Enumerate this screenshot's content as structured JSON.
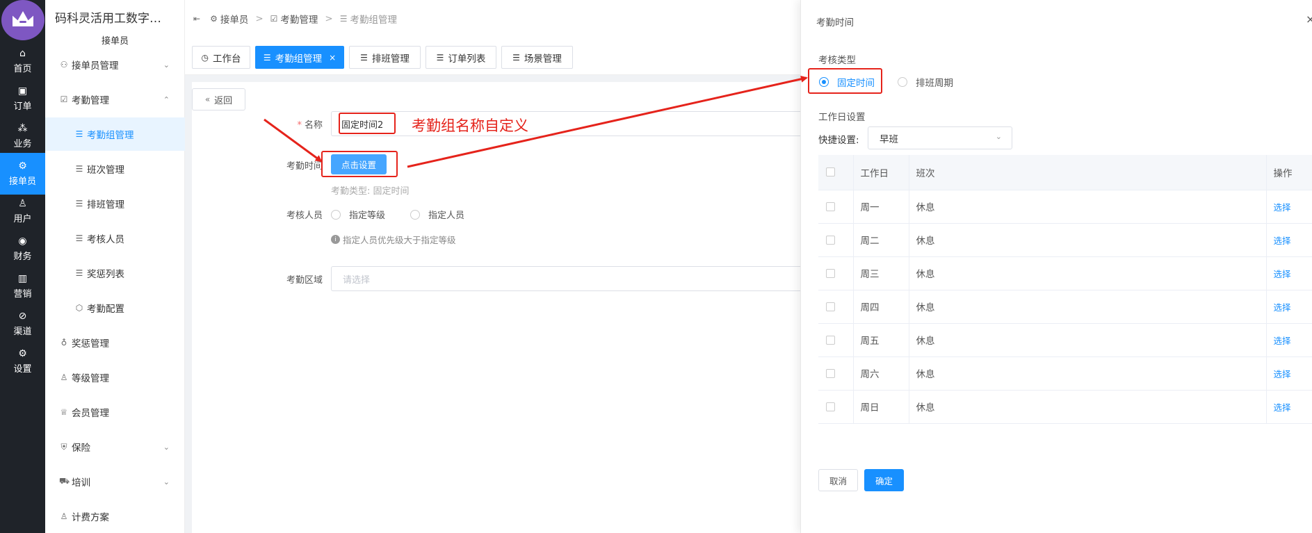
{
  "rail": [
    {
      "label": "首页",
      "icon": "⌂"
    },
    {
      "label": "订单",
      "icon": "▣"
    },
    {
      "label": "业务",
      "icon": "⁂"
    },
    {
      "label": "接单员",
      "icon": "⚙"
    },
    {
      "label": "用户",
      "icon": "♙"
    },
    {
      "label": "财务",
      "icon": "◉"
    },
    {
      "label": "营销",
      "icon": "▥"
    },
    {
      "label": "渠道",
      "icon": "⊘"
    },
    {
      "label": "设置",
      "icon": "⚙"
    }
  ],
  "sidebar": {
    "app_name": "码科灵活用工数字…",
    "role": "接单员",
    "items": [
      {
        "label": "接单员管理",
        "icon": "⚇",
        "chevron": "⌄"
      },
      {
        "label": "考勤管理",
        "icon": "☑",
        "chevron": "⌃"
      },
      {
        "label": "考勤组管理",
        "icon": "☰"
      },
      {
        "label": "班次管理",
        "icon": "☰"
      },
      {
        "label": "排班管理",
        "icon": "☰"
      },
      {
        "label": "考核人员",
        "icon": "☰"
      },
      {
        "label": "奖惩列表",
        "icon": "☰"
      },
      {
        "label": "考勤配置",
        "icon": "⬡"
      },
      {
        "label": "奖惩管理",
        "icon": "♁"
      },
      {
        "label": "等级管理",
        "icon": "♙"
      },
      {
        "label": "会员管理",
        "icon": "♕"
      },
      {
        "label": "保险",
        "icon": "⛨",
        "chevron": "⌄"
      },
      {
        "label": "培训",
        "icon": "⛟",
        "chevron": "⌄"
      },
      {
        "label": "计费方案",
        "icon": "♙"
      }
    ]
  },
  "breadcrumb": {
    "toggle": "⇤",
    "items": [
      "接单员",
      "考勤管理",
      "考勤组管理"
    ],
    "sep": ">"
  },
  "tabs": [
    {
      "label": "工作台",
      "icon": "◷"
    },
    {
      "label": "考勤组管理",
      "icon": "☰",
      "close": "×"
    },
    {
      "label": "排班管理",
      "icon": "☰"
    },
    {
      "label": "订单列表",
      "icon": "☰"
    },
    {
      "label": "场景管理",
      "icon": "☰"
    }
  ],
  "form": {
    "back": "返回",
    "back_icon": "«",
    "name_label": "名称",
    "required_mark": "*",
    "name_value": "固定时间2",
    "name_annotation": "考勤组名称自定义",
    "time_label": "考勤时间",
    "set_button": "点击设置",
    "type_hint": "考勤类型:  固定时间",
    "staff_label": "考核人员",
    "staff_options": [
      "指定等级",
      "指定人员"
    ],
    "info_hint": "指定人员优先级大于指定等级",
    "area_label": "考勤区域",
    "area_placeholder": "请选择"
  },
  "drawer": {
    "title": "考勤时间",
    "close": "×",
    "type_label": "考核类型",
    "type_options": [
      "固定时间",
      "排班周期"
    ],
    "workday_label": "工作日设置",
    "quick_label": "快捷设置:",
    "quick_value": "早班",
    "table": {
      "headers": [
        "工作日",
        "班次",
        "操作"
      ],
      "rows": [
        {
          "day": "周一",
          "shift": "休息",
          "op": "选择"
        },
        {
          "day": "周二",
          "shift": "休息",
          "op": "选择"
        },
        {
          "day": "周三",
          "shift": "休息",
          "op": "选择"
        },
        {
          "day": "周四",
          "shift": "休息",
          "op": "选择"
        },
        {
          "day": "周五",
          "shift": "休息",
          "op": "选择"
        },
        {
          "day": "周六",
          "shift": "休息",
          "op": "选择"
        },
        {
          "day": "周日",
          "shift": "休息",
          "op": "选择"
        }
      ]
    },
    "cancel": "取消",
    "confirm": "确定"
  },
  "colors": {
    "primary": "#1890ff",
    "rail": "#1f2329",
    "annotation": "#e5231b",
    "logo": "#7e57c2"
  }
}
